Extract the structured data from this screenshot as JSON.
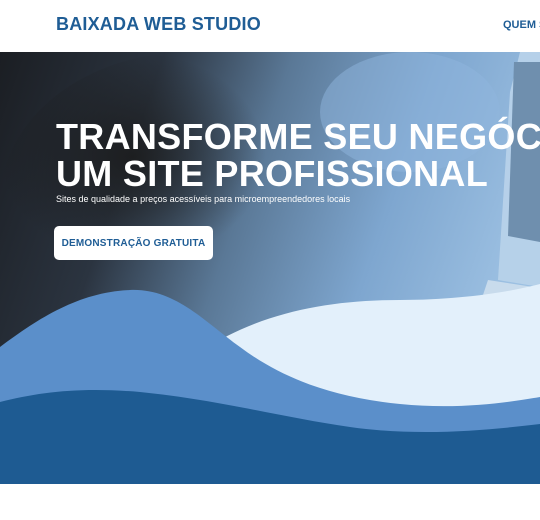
{
  "header": {
    "brand": "BAIXADA WEB STUDIO",
    "nav_item": "QUEM S"
  },
  "hero": {
    "title_line1": "TRANSFORME SEU NEGÓCIO",
    "title_line2": "UM SITE PROFISSIONAL",
    "subtitle": "Sites de qualidade a preços acessíveis para microempreendedores locais",
    "cta_label": "DEMONSTRAÇÃO GRATUITA"
  },
  "colors": {
    "brand_blue": "#1f5d95",
    "wave_mid": "#5b8fca",
    "wave_light": "#e3f0fb",
    "wave_dark": "#1e5b92"
  }
}
